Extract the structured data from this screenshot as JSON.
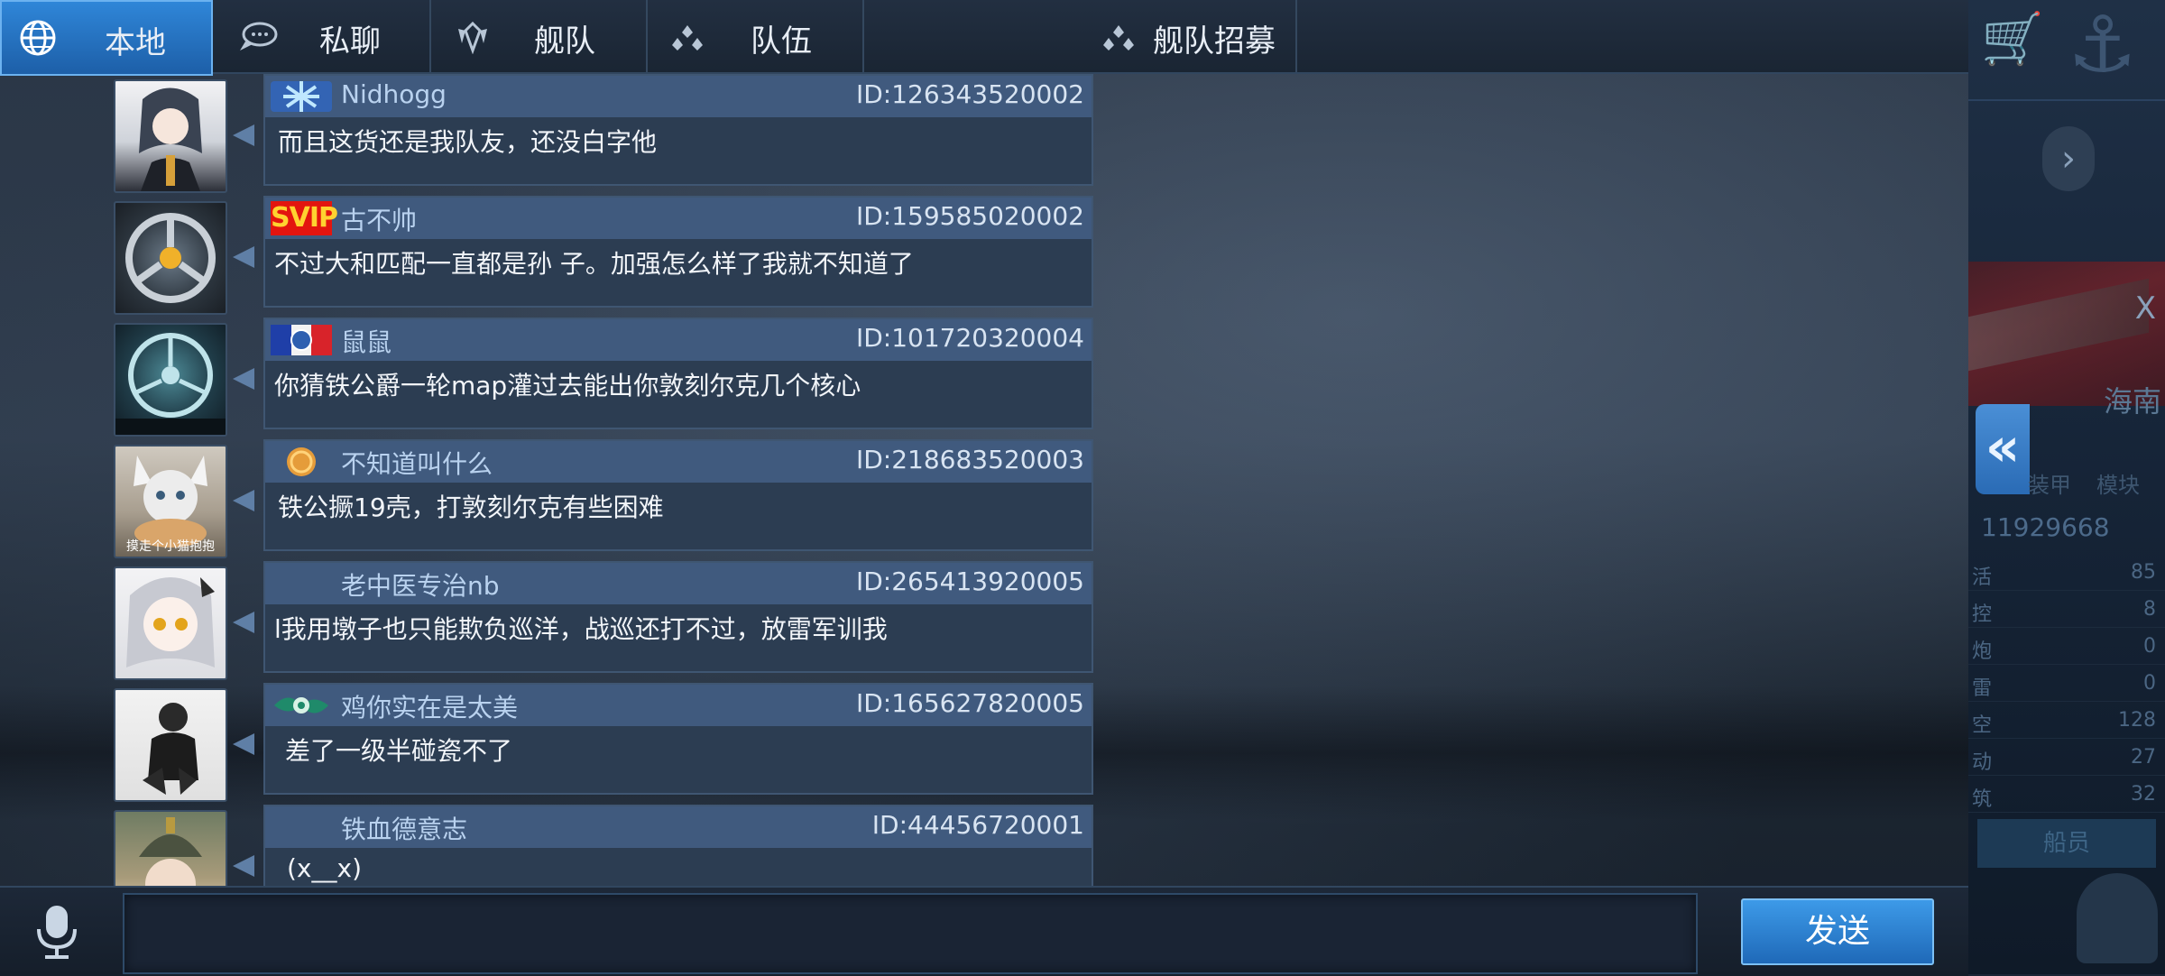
{
  "tabs": [
    {
      "label": "本地",
      "icon": "globe-icon",
      "active": true
    },
    {
      "label": "私聊",
      "icon": "chat-bubble-icon",
      "active": false
    },
    {
      "label": "舰队",
      "icon": "fleet-emblem-icon",
      "active": false
    },
    {
      "label": "队伍",
      "icon": "team-icon",
      "active": false
    },
    {
      "label": "舰队招募",
      "icon": "recruit-icon",
      "active": false
    }
  ],
  "messages": [
    {
      "name": "Nidhogg",
      "id": "ID:126343520002",
      "text": "而且这货还是我队友，还没白字他",
      "badge": "snowflake"
    },
    {
      "name": "古不帅",
      "id": "ID:159585020002",
      "text": "不过大和匹配一直都是孙  子。加强怎么样了我就不知道了",
      "badge": "SVIP"
    },
    {
      "name": "鼠鼠",
      "id": "ID:101720320004",
      "text": "你猜铁公爵一轮map灌过去能出你敦刻尔克几个核心",
      "badge": "flag"
    },
    {
      "name": "不知道叫什么",
      "id": "ID:218683520003",
      "text": "铁公撅19壳，打敦刻尔克有些困难",
      "badge": "coin"
    },
    {
      "name": "老中医专治nb",
      "id": "ID:265413920005",
      "text": "l我用墩子也只能欺负巡洋，战巡还打不过，放雷军训我",
      "badge": ""
    },
    {
      "name": "鸡你实在是太美",
      "id": "ID:165627820005",
      "text": "差了一级半碰瓷不了",
      "badge": "green-emblem"
    },
    {
      "name": "铁血德意志",
      "id": "ID:44456720001",
      "text": "(x__x)",
      "badge": ""
    }
  ],
  "avatar_captions": {
    "m3": "摸走个小猫抱抱"
  },
  "input": {
    "value": ""
  },
  "send_label": "发送",
  "side_panel": {
    "close": "X",
    "place": "海南",
    "small_tabs": [
      "装甲",
      "模块"
    ],
    "big_number": "11929668",
    "stats": [
      {
        "k": "活",
        "v": "85"
      },
      {
        "k": "控",
        "v": "8"
      },
      {
        "k": "炮",
        "v": "0"
      },
      {
        "k": "雷",
        "v": "0"
      },
      {
        "k": "空",
        "v": "128"
      },
      {
        "k": "动",
        "v": "27"
      },
      {
        "k": "筑",
        "v": "32"
      }
    ],
    "crew_label": "船员"
  },
  "colors": {
    "accent": "#2f86d8",
    "svip_bg": "#e3150f",
    "svip_text": "#ffd230",
    "header_bar": "#405a7e"
  }
}
